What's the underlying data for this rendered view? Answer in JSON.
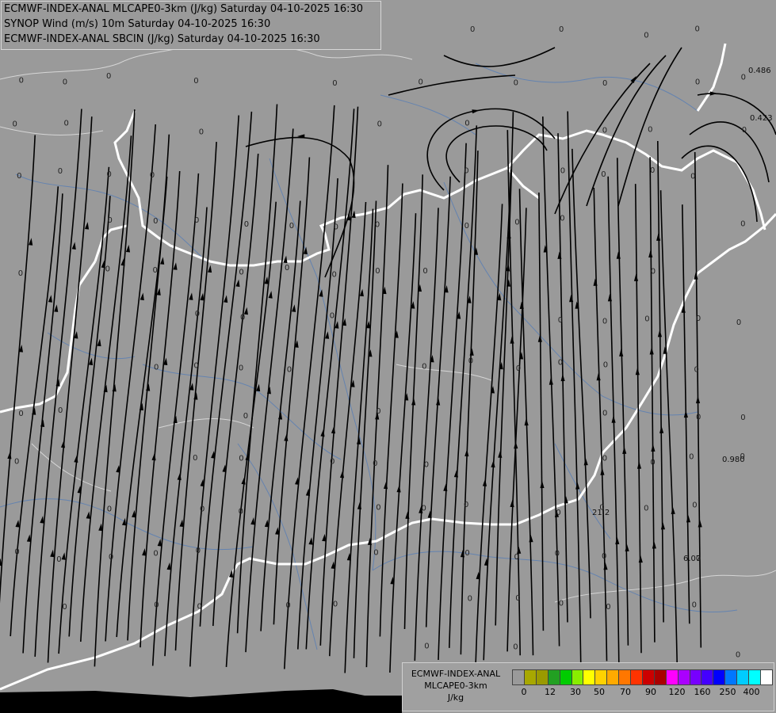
{
  "header": {
    "line1": "ECMWF-INDEX-ANAL MLCAPE0-3km (J/kg) Saturday 04-10-2025 16:30",
    "line2": "SYNOP Wind (m/s) 10m Saturday 04-10-2025 16:30",
    "line3": "ECMWF-INDEX-ANAL SBCIN (J/kg) Saturday 04-10-2025 16:30"
  },
  "legend": {
    "line1": "ECMWF-INDEX-ANAL",
    "line2": "MLCAPE0-3km",
    "line3": "J/kg",
    "colors": [
      "#9a9a9a",
      "#a8a800",
      "#9a9a00",
      "#22a022",
      "#00cc00",
      "#88ee00",
      "#ffff00",
      "#ffd200",
      "#ffaa00",
      "#ff7700",
      "#ff3300",
      "#cc0000",
      "#aa0000",
      "#ff00ff",
      "#aa00ff",
      "#7700ff",
      "#4400ff",
      "#0000ff",
      "#0077ff",
      "#00ccff",
      "#00ffff",
      "#ffffff"
    ],
    "ticks": [
      "0",
      "12",
      "30",
      "50",
      "70",
      "90",
      "120",
      "160",
      "250",
      "400"
    ]
  },
  "map": {
    "cin_labels": [
      "0.486",
      "0.423",
      "0.980",
      "21.2",
      "6.07"
    ],
    "zero_label": "0"
  }
}
